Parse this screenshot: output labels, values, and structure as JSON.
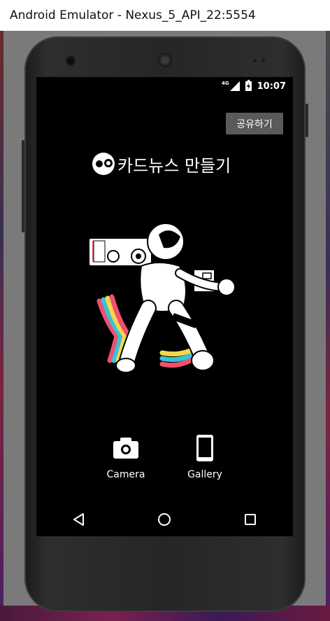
{
  "window": {
    "title": "Android Emulator - Nexus_5_API_22:5554"
  },
  "statusbar": {
    "network": "4G",
    "time": "10:07",
    "icons": [
      "signal-icon",
      "battery-charging-icon"
    ]
  },
  "app": {
    "share_label": "공유하기",
    "title": "카드뉴스 만들기",
    "logo_icon": "eyes-logo-icon",
    "illustration": "astronaut-boombox-illustration"
  },
  "actions": [
    {
      "label": "Camera",
      "icon": "camera-icon"
    },
    {
      "label": "Gallery",
      "icon": "phone-gallery-icon"
    }
  ],
  "navbar": {
    "icons": [
      "back-icon",
      "home-icon",
      "recents-icon"
    ]
  },
  "colors": {
    "screen_bg": "#000000",
    "share_button": "#5a5a5a",
    "text": "#ffffff"
  }
}
